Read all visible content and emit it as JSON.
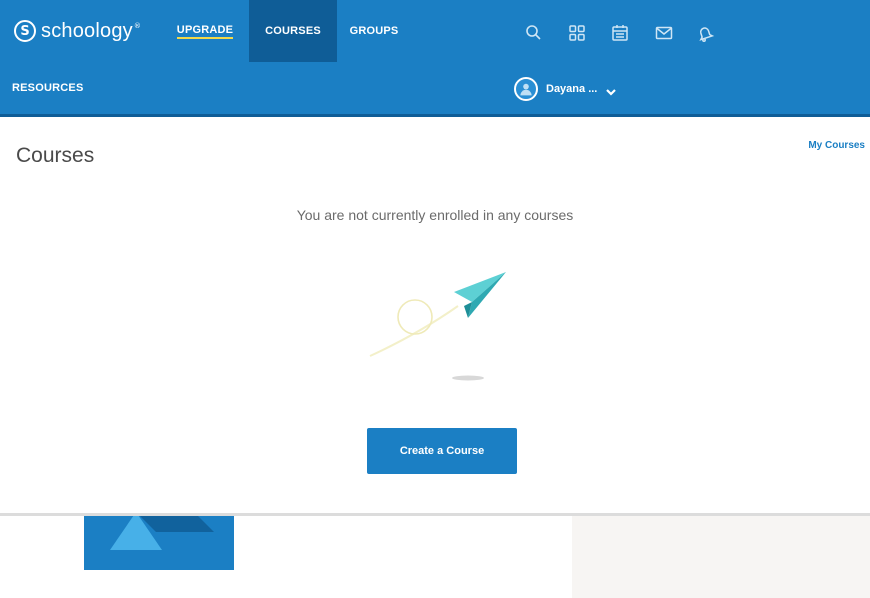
{
  "brand": {
    "name": "schoology",
    "mark": "S",
    "tm": "®"
  },
  "nav": {
    "upgrade": "UPGRADE",
    "courses": "COURSES",
    "groups": "GROUPS",
    "resources": "RESOURCES"
  },
  "icons": [
    "search-icon",
    "apps-grid-icon",
    "calendar-icon",
    "mail-icon",
    "bell-icon"
  ],
  "user": {
    "name": "Dayana ..."
  },
  "page": {
    "title": "Courses",
    "my_courses_link": "My Courses",
    "empty_message": "You are not currently enrolled in any courses",
    "create_button": "Create a Course"
  },
  "colors": {
    "brand_blue": "#1b7fc4",
    "active_nav": "#0f5d97",
    "upgrade_underline": "#f2d94a",
    "plane": "#3ec3c9"
  }
}
